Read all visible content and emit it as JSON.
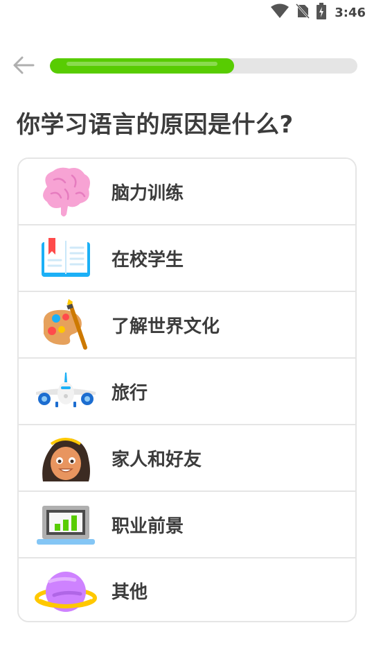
{
  "status_bar": {
    "time": "3:46",
    "icons": [
      "wifi-icon",
      "no-sim-icon",
      "battery-charging-icon"
    ]
  },
  "progress": {
    "fraction": 0.6
  },
  "colors": {
    "accent_green": "#58cc02",
    "border_gray": "#e5e5e5",
    "text_dark": "#3c3c3c"
  },
  "page": {
    "title": "你学习语言的原因是什么?"
  },
  "options": [
    {
      "label": "脑力训练",
      "icon": "brain-icon"
    },
    {
      "label": "在校学生",
      "icon": "book-icon"
    },
    {
      "label": "了解世界文化",
      "icon": "palette-icon"
    },
    {
      "label": "旅行",
      "icon": "airplane-icon"
    },
    {
      "label": "家人和好友",
      "icon": "person-face-icon"
    },
    {
      "label": "职业前景",
      "icon": "laptop-chart-icon"
    },
    {
      "label": "其他",
      "icon": "planet-icon"
    }
  ]
}
